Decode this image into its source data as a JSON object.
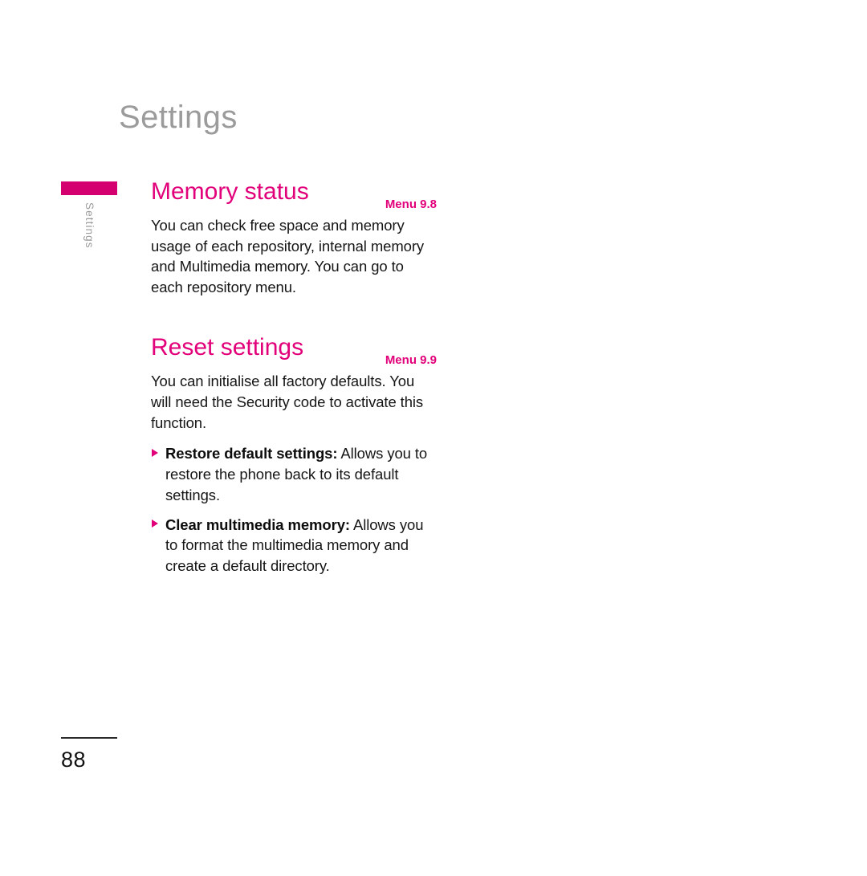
{
  "document": {
    "chapter_title": "Settings",
    "side_tab_label": "Settings",
    "page_number": "88",
    "accent_color": "#e2007a",
    "tab_bar_color": "#d4006f",
    "chapter_title_color": "#9b9b9b",
    "body_text_color": "#161616"
  },
  "sections": [
    {
      "title": "Memory status",
      "menu_ref": "Menu 9.8",
      "body": "You can check free space and memory usage of each repository, internal memory and Multimedia memory. You can go to each repository menu."
    },
    {
      "title": "Reset settings",
      "menu_ref": "Menu 9.9",
      "body": "You can initialise all factory defaults. You will need the Security code to activate this function.",
      "bullets": [
        {
          "term": "Restore default settings:",
          "description": " Allows you to restore the phone back to its default settings."
        },
        {
          "term": "Clear multimedia memory:",
          "description": " Allows you to format the multimedia memory and create a default directory."
        }
      ]
    }
  ]
}
